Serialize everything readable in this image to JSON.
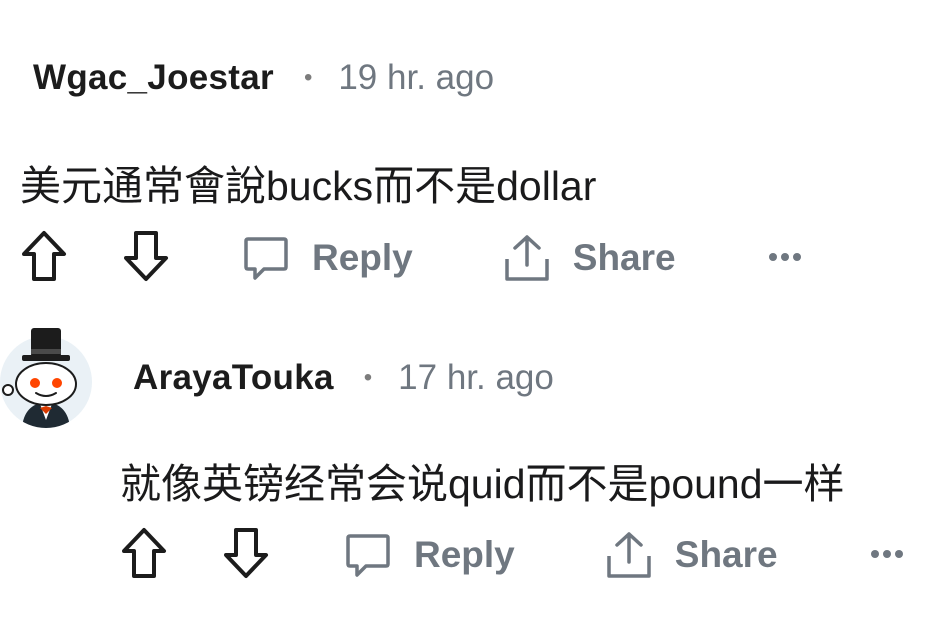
{
  "comments": [
    {
      "author": "Wgac_Joestar",
      "separator": "•",
      "time": "19 hr. ago",
      "text": "美元通常會說bucks而不是dollar",
      "reply_label": "Reply",
      "share_label": "Share",
      "more_label": "•••"
    },
    {
      "author": "ArayaTouka",
      "separator": "•",
      "time": "17 hr. ago",
      "text": "就像英镑经常会说quid而不是pound一样",
      "reply_label": "Reply",
      "share_label": "Share",
      "more_label": "•••",
      "avatar": "reddit-snoo-avatar"
    }
  ],
  "colors": {
    "text": "#1a1a1b",
    "meta": "#6f7780",
    "icons": "#1c1c1c"
  }
}
